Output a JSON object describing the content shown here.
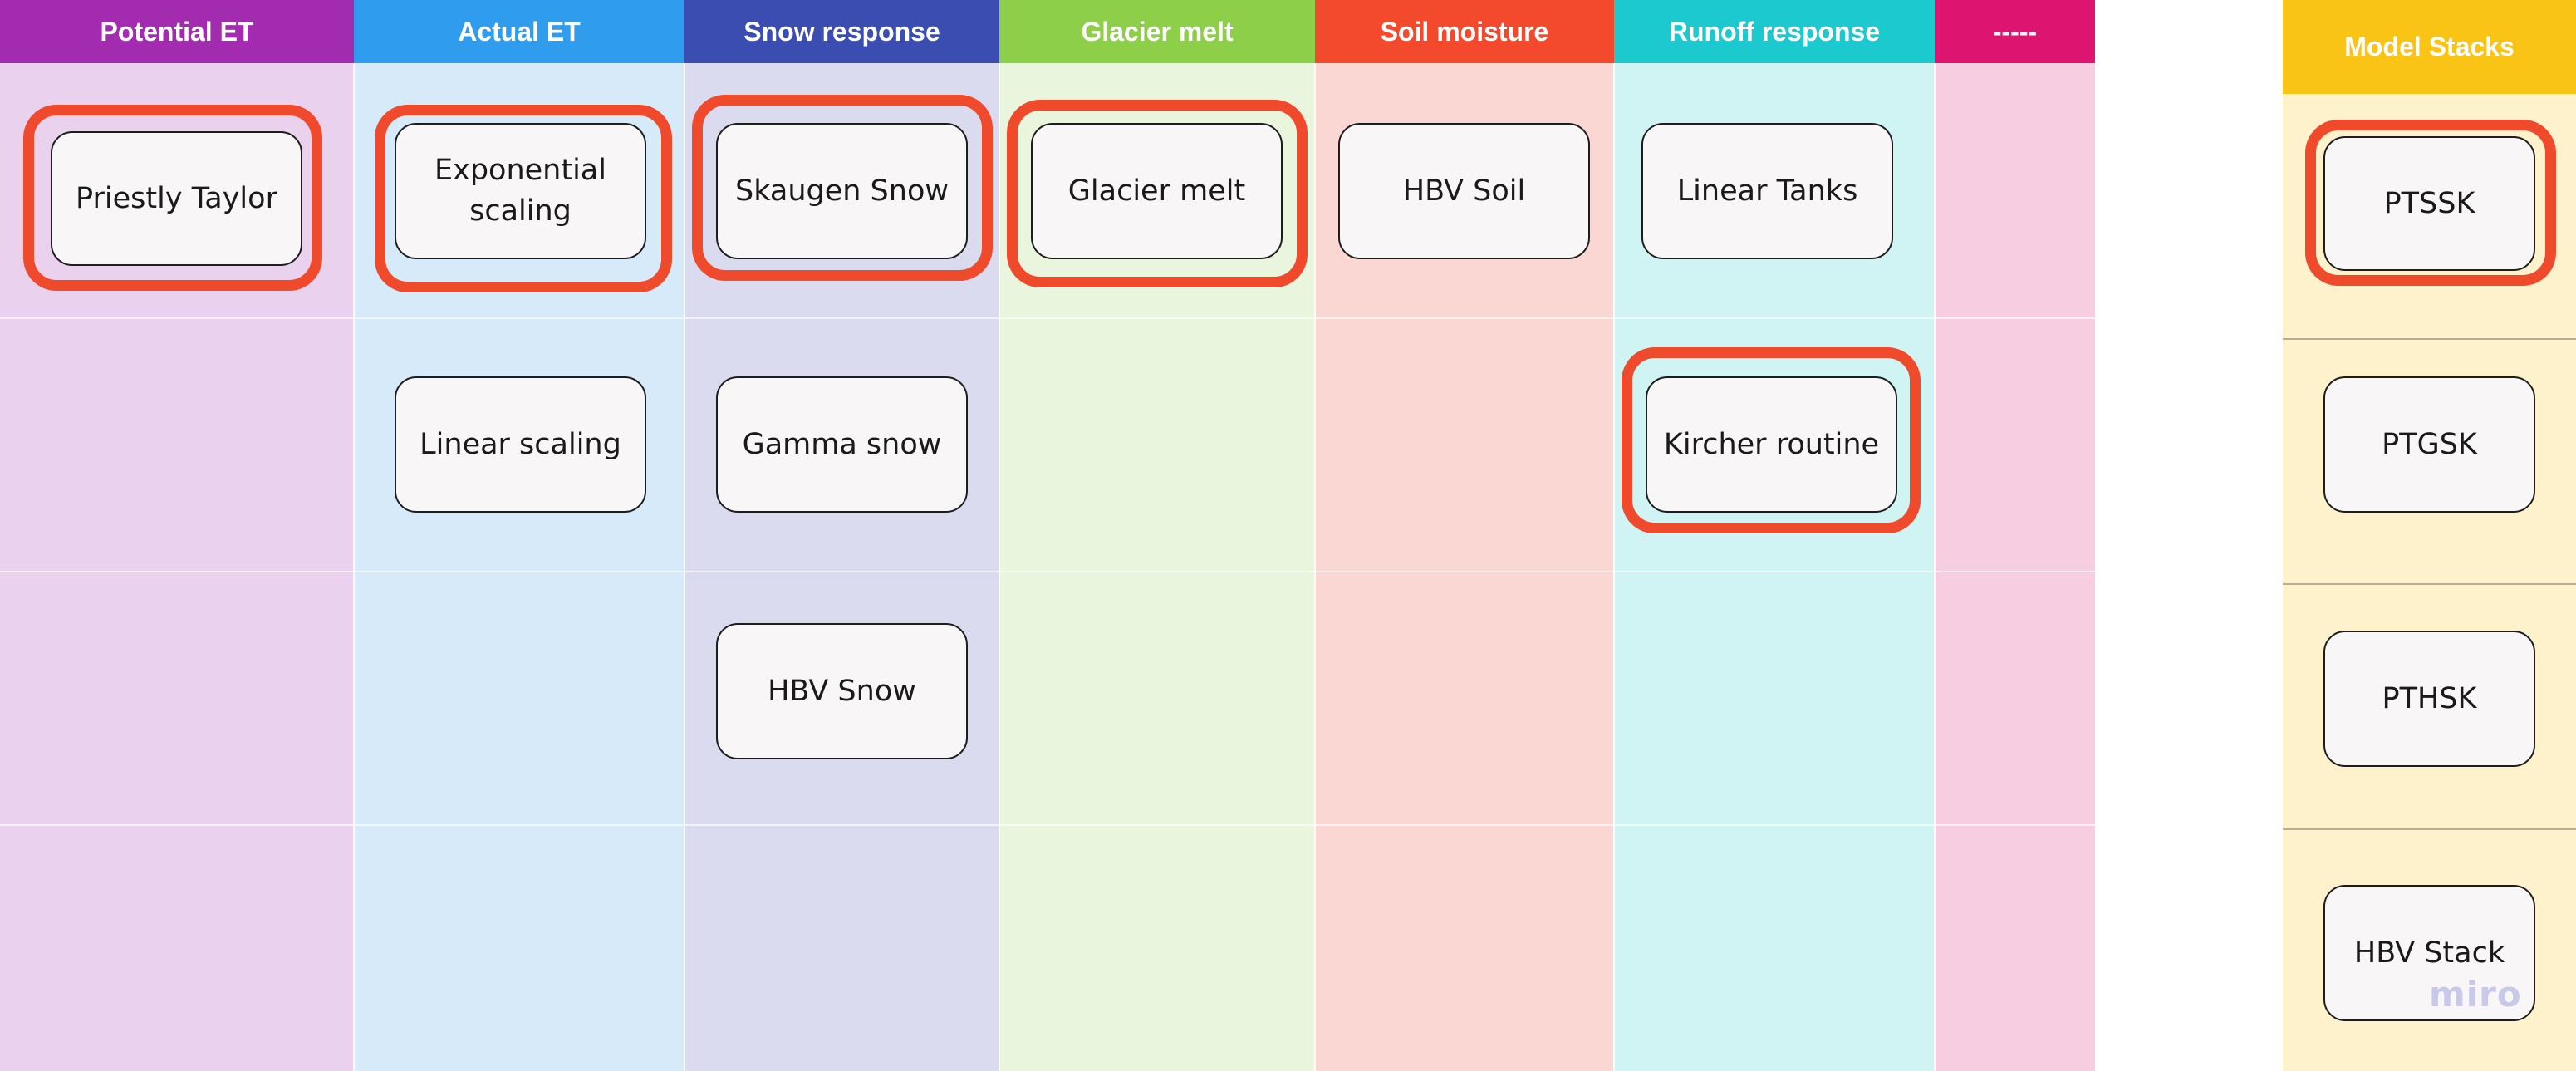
{
  "columns": [
    {
      "id": "pet",
      "title": "Potential ET",
      "header_color": "#a22bb0",
      "body_color": "#ead2ee"
    },
    {
      "id": "aet",
      "title": "Actual ET",
      "header_color": "#2f9ced",
      "body_color": "#d6eafa"
    },
    {
      "id": "snow",
      "title": "Snow response",
      "header_color": "#3c4db2",
      "body_color": "#dbdbf0"
    },
    {
      "id": "glacier",
      "title": "Glacier melt",
      "header_color": "#8ecf4a",
      "body_color": "#e9f5dc"
    },
    {
      "id": "soil",
      "title": "Soil moisture",
      "header_color": "#f3492d",
      "body_color": "#fad7d3"
    },
    {
      "id": "runoff",
      "title": "Runoff response",
      "header_color": "#1cc9cf",
      "body_color": "#d0f3f4"
    },
    {
      "id": "extra",
      "title": "-----",
      "header_color": "#dd1570",
      "body_color": "#f6cde1"
    }
  ],
  "stacks_column": {
    "title": "Model Stacks",
    "header_color": "#f9c415",
    "body_color": "#fdf2cc"
  },
  "cards": {
    "priestly_taylor": {
      "label": "Priestly Taylor",
      "highlighted": true
    },
    "exponential_scaling": {
      "label": "Exponential scaling",
      "highlighted": true
    },
    "linear_scaling": {
      "label": "Linear scaling",
      "highlighted": false
    },
    "skaugen_snow": {
      "label": "Skaugen Snow",
      "highlighted": true
    },
    "gamma_snow": {
      "label": "Gamma snow",
      "highlighted": false
    },
    "hbv_snow": {
      "label": "HBV Snow",
      "highlighted": false
    },
    "glacier_melt": {
      "label": "Glacier melt",
      "highlighted": true
    },
    "hbv_soil": {
      "label": "HBV Soil",
      "highlighted": false
    },
    "linear_tanks": {
      "label": "Linear Tanks",
      "highlighted": false
    },
    "kircher_routine": {
      "label": "Kircher routine",
      "highlighted": true
    },
    "ptssk": {
      "label": "PTSSK",
      "highlighted": true
    },
    "ptgsk": {
      "label": "PTGSK",
      "highlighted": false
    },
    "pthsk": {
      "label": "PTHSK",
      "highlighted": false
    },
    "hbv_stack": {
      "label": "HBV Stack",
      "highlighted": false
    }
  },
  "colors": {
    "highlight": "#ef4a2b",
    "card_fill": "#f8f6f6",
    "card_border": "#1d1d1d"
  },
  "watermark": "miro"
}
